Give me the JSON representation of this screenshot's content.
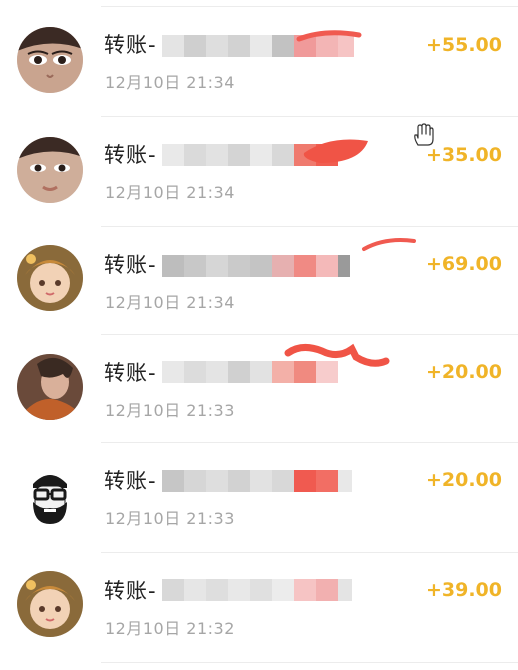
{
  "accent_color": "#f0b428",
  "transactions": [
    {
      "title": "转账-",
      "time": "12月10日 21:34",
      "amount": "+55.00",
      "avatar_icon": "woman-eyes-avatar-icon"
    },
    {
      "title": "转账-",
      "time": "12月10日 21:34",
      "amount": "+35.00",
      "avatar_icon": "woman-face-avatar-icon"
    },
    {
      "title": "转账-",
      "time": "12月10日 21:34",
      "amount": "+69.00",
      "avatar_icon": "doll-avatar-icon"
    },
    {
      "title": "转账-",
      "time": "12月10日 21:33",
      "amount": "+20.00",
      "avatar_icon": "portrait-avatar-icon"
    },
    {
      "title": "转账-",
      "time": "12月10日 21:33",
      "amount": "+20.00",
      "avatar_icon": "bearded-man-avatar-icon"
    },
    {
      "title": "转账-",
      "time": "12月10日 21:32",
      "amount": "+39.00",
      "avatar_icon": "doll-avatar-icon"
    }
  ]
}
